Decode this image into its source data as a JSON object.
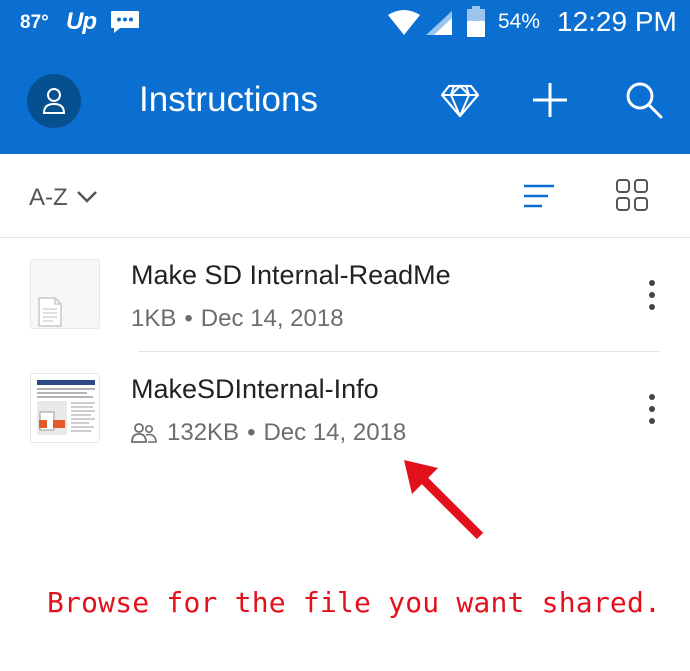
{
  "status_bar": {
    "temperature": "87°",
    "carrier_logo": "Up",
    "battery_percent": "54%",
    "time": "12:29 PM",
    "icons": [
      "message-icon",
      "wifi-icon",
      "signal-icon",
      "battery-icon"
    ]
  },
  "app_bar": {
    "title": "Instructions",
    "color": "#0a6fd1",
    "actions": [
      "premium-diamond-icon",
      "add-icon",
      "search-icon"
    ]
  },
  "sort_bar": {
    "sort_label": "A-Z",
    "view_modes": [
      "list-view-icon",
      "grid-view-icon"
    ],
    "active_view": "list"
  },
  "files": [
    {
      "name": "Make SD Internal-ReadMe",
      "size": "1KB",
      "date": "Dec 14, 2018",
      "shared": false
    },
    {
      "name": "MakeSDInternal-Info",
      "size": "132KB",
      "date": "Dec 14, 2018",
      "shared": true
    }
  ],
  "meta_separator": "•",
  "annotation": {
    "caption": "Browse for the file you want shared.",
    "color": "#e3111c"
  }
}
